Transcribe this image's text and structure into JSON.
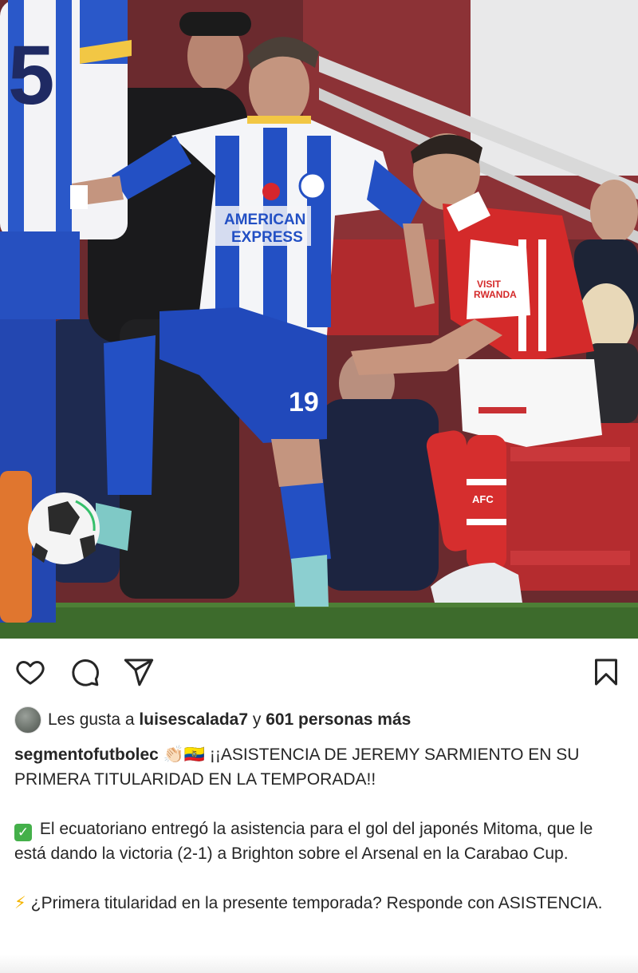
{
  "post": {
    "image_alt": "Futbolistas de Brighton y Arsenal disputando el balón",
    "jersey_number_home": "19",
    "jersey_number_back": "5",
    "shirt_sponsor_home": [
      "AMERICAN",
      "EXPRESS"
    ],
    "shirt_sponsor_away": [
      "VISIT",
      "RWANDA"
    ],
    "sock_text_away": "AFC"
  },
  "actions": {
    "like_icon": "heart-icon",
    "comment_icon": "comment-icon",
    "share_icon": "send-icon",
    "save_icon": "bookmark-icon"
  },
  "likes": {
    "prefix": "Les gusta a ",
    "user": "luisescalada7",
    "middle": " y ",
    "others": "601 personas más"
  },
  "caption": {
    "username": "segmentofutbolec",
    "emojis": "👏🏻🇪🇨",
    "headline": " ¡¡ASISTENCIA DE JEREMY SARMIENTO EN SU PRIMERA TITULARIDAD EN LA TEMPORADA!!",
    "para1_icon": "✅",
    "para1": " El ecuatoriano entregó la asistencia para el gol del japonés Mitoma, que le está dando la victoria (2-1) a Brighton sobre el Arsenal en la Carabao Cup.",
    "para2_icon": "⚡",
    "para2": "¿Primera titularidad en la presente temporada? Responde con ASISTENCIA."
  },
  "colors": {
    "brighton_blue": "#1f4fc4",
    "arsenal_red": "#d42a2a",
    "pitch_green": "#3d6b2c",
    "text": "#262626"
  }
}
